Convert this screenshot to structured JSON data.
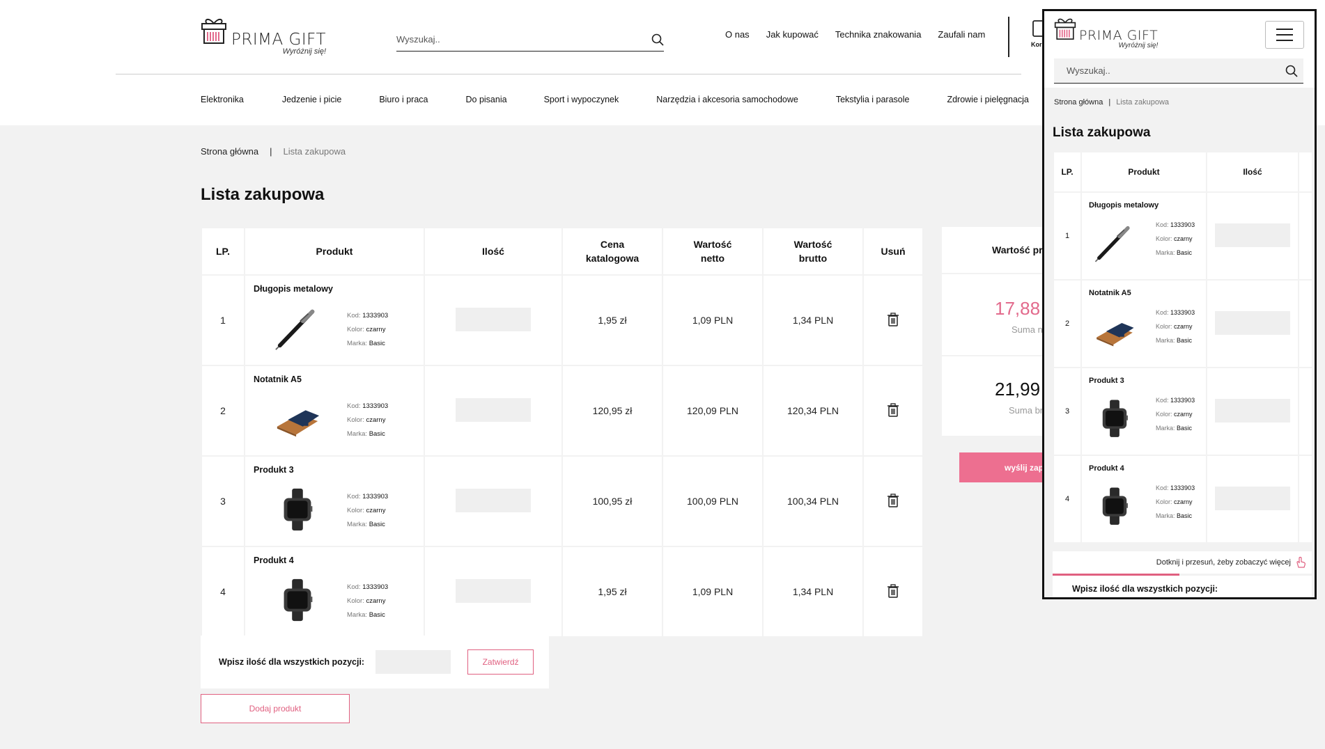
{
  "brand": {
    "name": "PRIMA GIFT",
    "tagline": "Wyróżnij się!"
  },
  "search": {
    "placeholder": "Wyszukaj.."
  },
  "topnav": [
    "O nas",
    "Jak kupować",
    "Technika znakowania",
    "Zaufali nam"
  ],
  "cart_label": "Kor",
  "categories": [
    "Elektronika",
    "Jedzenie i picie",
    "Biuro i praca",
    "Do pisania",
    "Sport i wypoczynek",
    "Narzędzia i akcesoria samochodowe",
    "Tekstylia i parasole",
    "Zdrowie i pielęgnacja"
  ],
  "breadcrumb": {
    "home": "Strona główna",
    "current": "Lista zakupowa"
  },
  "page_title": "Lista zakupowa",
  "table": {
    "headers": {
      "lp": "LP.",
      "product": "Produkt",
      "qty": "Ilość",
      "catalog_l1": "Cena",
      "catalog_l2": "katalogowa",
      "net_l1": "Wartość",
      "net_l2": "netto",
      "gross_l1": "Wartość",
      "gross_l2": "brutto",
      "remove": "Usuń"
    },
    "meta_labels": {
      "code": "Kod:",
      "color": "Kolor:",
      "brand": "Marka:"
    },
    "rows": [
      {
        "lp": "1",
        "name": "Długopis metalowy",
        "code": "1333903",
        "color": "czarny",
        "brand": "Basic",
        "catalog": "1,95 zł",
        "net": "1,09 PLN",
        "gross": "1,34 PLN",
        "img": "pen"
      },
      {
        "lp": "2",
        "name": "Notatnik A5",
        "code": "1333903",
        "color": "czarny",
        "brand": "Basic",
        "catalog": "120,95 zł",
        "net": "120,09 PLN",
        "gross": "120,34 PLN",
        "img": "notebook"
      },
      {
        "lp": "3",
        "name": "Produkt 3",
        "code": "1333903",
        "color": "czarny",
        "brand": "Basic",
        "catalog": "100,95 zł",
        "net": "100,09 PLN",
        "gross": "100,34 PLN",
        "img": "watch"
      },
      {
        "lp": "4",
        "name": "Produkt 4",
        "code": "1333903",
        "color": "czarny",
        "brand": "Basic",
        "catalog": "1,95 zł",
        "net": "1,09 PLN",
        "gross": "1,34 PLN",
        "img": "watch"
      }
    ]
  },
  "bulk": {
    "label": "Wpisz ilość dla wszystkich pozycji:",
    "confirm": "Zatwierdź"
  },
  "add_product": "Dodaj produkt",
  "summary": {
    "header": "Wartość pro",
    "net_value": "17,88",
    "net_label": "Suma n",
    "gross_value": "21,99",
    "gross_label": "Suma br"
  },
  "send_button": "wyślij zapy",
  "mobile": {
    "hint": "Dotknij i przesuń, żeby zobaczyć więcej"
  },
  "colors": {
    "accent": "#ed6f90",
    "background": "#f2f2f2"
  }
}
